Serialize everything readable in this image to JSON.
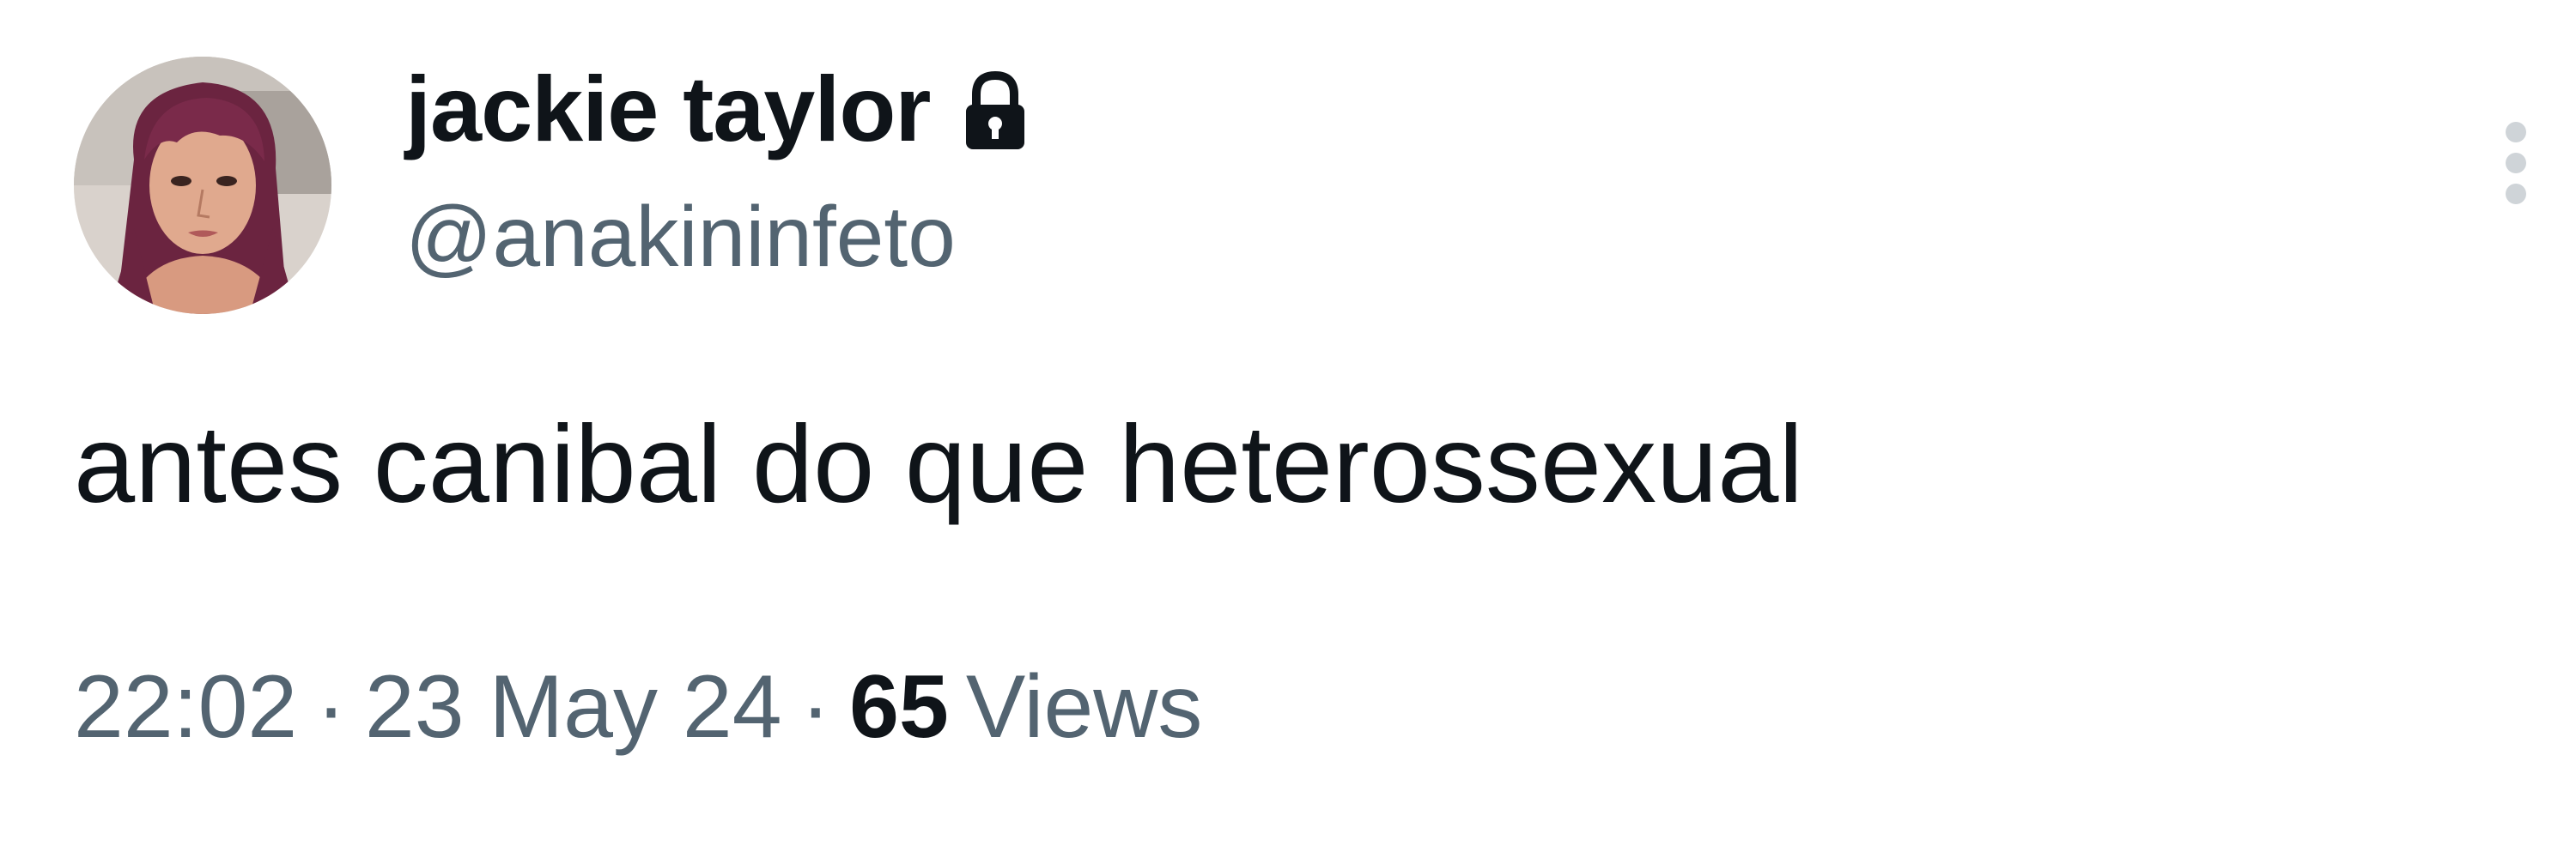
{
  "tweet": {
    "author": {
      "display_name": "jackie taylor",
      "handle": "@anakininfeto",
      "protected_icon": "lock-icon",
      "avatar": "profile-photo"
    },
    "text": "antes canibal do que heterossexual",
    "time": "22:02",
    "separator": "·",
    "date": "23 May 24",
    "views_count": "65",
    "views_label": "Views",
    "more_icon": "more-vertical-icon"
  },
  "colors": {
    "text_primary": "#0f1419",
    "text_secondary": "#536471",
    "background": "#ffffff",
    "more_dots": "#cfd4d8"
  }
}
